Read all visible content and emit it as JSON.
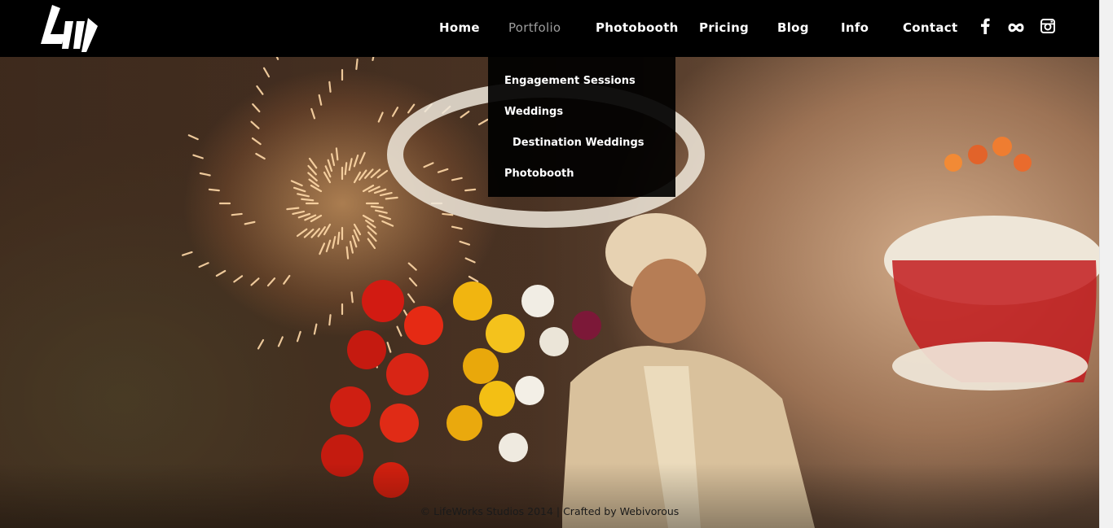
{
  "header": {
    "logo_alt": "LifeWorks Studios",
    "nav": [
      {
        "label": "Home"
      },
      {
        "label": "Portfolio"
      },
      {
        "label": "Photobooth"
      },
      {
        "label": "Pricing"
      },
      {
        "label": "Blog"
      },
      {
        "label": "Info"
      },
      {
        "label": "Contact"
      }
    ],
    "active_nav": "Portfolio",
    "social": [
      {
        "icon": "facebook-icon"
      },
      {
        "icon": "flickr-icon"
      },
      {
        "icon": "instagram-icon"
      }
    ]
  },
  "portfolio_menu": {
    "items": [
      {
        "label": "Engagement Sessions"
      },
      {
        "label": "Weddings"
      },
      {
        "label": "Destination Weddings"
      },
      {
        "label": "Photobooth"
      }
    ]
  },
  "hero": {
    "image_alt": "Groom in traditional attire seated with flowers and fireworks"
  },
  "footer": {
    "copyright": "© LifeWorks Studios 2014 | Crafted by ",
    "credit_link": "Webivorous"
  },
  "colors": {
    "header_bg": "#000000",
    "nav_text": "#ffffff",
    "nav_active": "#9d9d9d",
    "dropdown_bg": "#000000"
  }
}
